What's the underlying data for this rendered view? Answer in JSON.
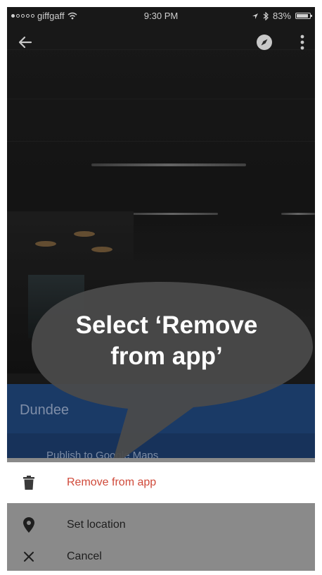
{
  "status_bar": {
    "carrier": "giffgaff",
    "time": "9:30 PM",
    "battery": "83%"
  },
  "top_bar": {
    "back_icon": "arrow-left-icon",
    "compass_icon": "compass-icon",
    "more_icon": "more-vertical-icon"
  },
  "place": {
    "name": "Dundee",
    "publish_label": "Publish to Google Maps"
  },
  "callout": {
    "line1": "Select ‘Remove",
    "line2": "from app’"
  },
  "menu": {
    "items": [
      {
        "label": "Remove from app",
        "icon": "trash-icon"
      },
      {
        "label": "Set location",
        "icon": "location-pin-icon"
      },
      {
        "label": "Cancel",
        "icon": "close-icon"
      }
    ]
  },
  "colors": {
    "destructive": "#d04a3a",
    "sheet_blue": "#1a3a66",
    "callout_bubble": "#4a4a4a"
  }
}
